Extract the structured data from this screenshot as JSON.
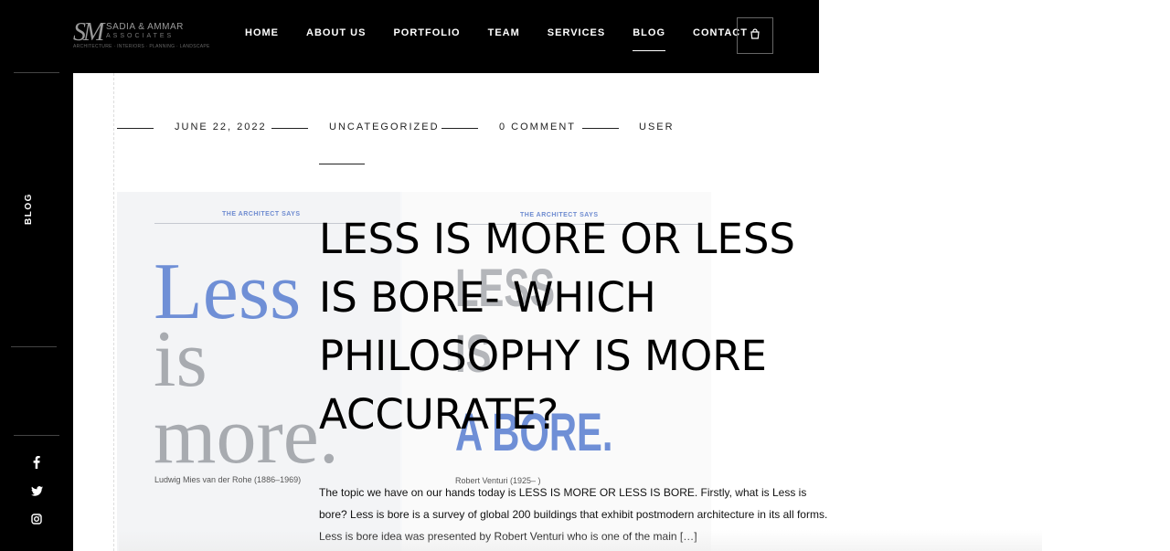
{
  "sidebar": {
    "label": "BLOG",
    "social": [
      {
        "icon": "facebook-icon",
        "glyph": "f"
      },
      {
        "icon": "twitter-icon",
        "glyph": "t"
      },
      {
        "icon": "instagram-icon",
        "glyph": "ig"
      }
    ]
  },
  "header": {
    "logo": {
      "mark": "SM",
      "name": "SADIA & AMMAR",
      "sub": "ASSOCIATES",
      "tagline": "ARCHITECTURE · INTERIORS · PLANNING · LANDSCAPE"
    },
    "nav": [
      {
        "label": "HOME",
        "active": false
      },
      {
        "label": "ABOUT US",
        "active": false
      },
      {
        "label": "PORTFOLIO",
        "active": false
      },
      {
        "label": "TEAM",
        "active": false
      },
      {
        "label": "SERVICES",
        "active": false
      },
      {
        "label": "BLOG",
        "active": true
      },
      {
        "label": "CONTACT",
        "active": false
      }
    ],
    "cart_icon": "bag-icon"
  },
  "post": {
    "meta": {
      "date": "JUNE 22, 2022",
      "category": "UNCATEGORIZED",
      "comments": "0 COMMENT",
      "author": "USER"
    },
    "title": "LESS IS MORE OR LESS IS BORE- WHICH PHILOSOPHY IS MORE ACCURATE?",
    "excerpt": "The topic we have on our hands today is LESS IS MORE OR LESS IS BORE. Firstly, what is Less is bore? Less is bore is a survey of global 200 buildings that exhibit postmodern architecture in its all forms. Less is bore idea was presented by Robert Venturi who is one of the main […]",
    "image": {
      "left_caption": "THE ARCHITECT SAYS",
      "right_caption": "THE ARCHITECT SAYS",
      "left_word1": "Less",
      "left_word2": "is",
      "left_word3": "more.",
      "right_word1": "LESS",
      "right_word2": "IS",
      "right_word3": "A BORE.",
      "left_credit": "Ludwig Mies van der Rohe (1886–1969)",
      "right_credit": "Robert Venturi (1925– )"
    }
  },
  "colors": {
    "bar_bg": "#000000",
    "accent_blue": "#6f8fd6",
    "text": "#111111"
  }
}
